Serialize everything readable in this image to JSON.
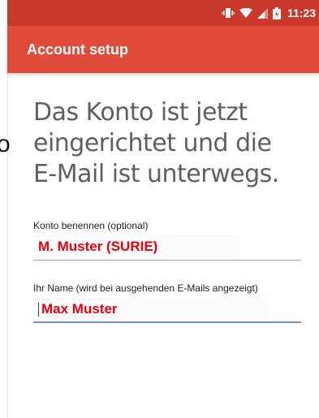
{
  "status_bar": {
    "time": "11:23",
    "icons": [
      "vibrate-icon",
      "wifi-icon",
      "signal-icon",
      "battery-icon"
    ]
  },
  "app_bar": {
    "title": "Account setup"
  },
  "left_edge": {
    "glyph": "o"
  },
  "main": {
    "headline": "Das Konto ist jetzt eingerichtet und die E-Mail ist unterwegs.",
    "account_name_field": {
      "label": "Konto benennen (optional)",
      "value": "M. Muster (SURIE)"
    },
    "your_name_field": {
      "label": "Ihr Name (wird bei ausgehenden E-Mails angezeigt)",
      "value": "Max Muster"
    }
  },
  "colors": {
    "status_bar": "#c8382b",
    "app_bar": "#e04b3a",
    "input_text": "#e3000f",
    "focus_underline": "#6c8fd6"
  }
}
